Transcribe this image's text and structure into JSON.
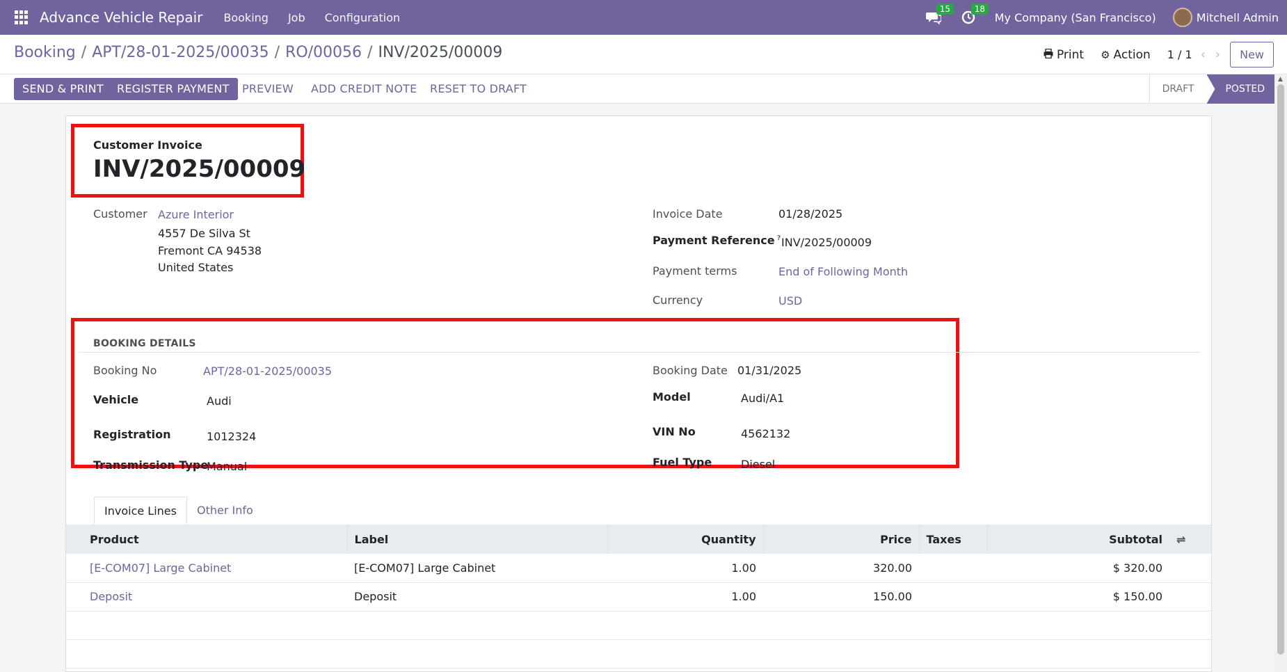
{
  "navbar": {
    "app_title": "Advance Vehicle Repair",
    "menu": [
      "Booking",
      "Job",
      "Configuration"
    ],
    "messages_count": "15",
    "activities_count": "18",
    "company": "My Company (San Francisco)",
    "user": "Mitchell Admin"
  },
  "control": {
    "breadcrumb": [
      "Booking",
      "APT/28-01-2025/00035",
      "RO/00056"
    ],
    "current": "INV/2025/00009",
    "print": "Print",
    "action": "Action",
    "pager": "1 / 1",
    "new": "New"
  },
  "actions": {
    "send_print": "SEND & PRINT",
    "register_payment": "REGISTER PAYMENT",
    "preview": "PREVIEW",
    "add_credit_note": "ADD CREDIT NOTE",
    "reset_to_draft": "RESET TO DRAFT"
  },
  "status": {
    "draft": "DRAFT",
    "posted": "POSTED"
  },
  "invoice": {
    "type": "Customer Invoice",
    "number": "INV/2025/00009",
    "customer_label": "Customer",
    "customer_name": "Azure Interior",
    "address1": "4557 De Silva St",
    "address2": "Fremont CA 94538",
    "address3": "United States",
    "date_label": "Invoice Date",
    "date": "01/28/2025",
    "payment_ref_label": "Payment Reference",
    "payment_ref_help": "?",
    "payment_ref": "INV/2025/00009",
    "terms_label": "Payment terms",
    "terms": "End of Following Month",
    "currency_label": "Currency",
    "currency": "USD"
  },
  "booking": {
    "title": "BOOKING DETAILS",
    "no_label": "Booking No",
    "no": "APT/28-01-2025/00035",
    "date_label": "Booking Date",
    "date": "01/31/2025",
    "vehicle_label": "Vehicle",
    "vehicle": "Audi",
    "model_label": "Model",
    "model": "Audi/A1",
    "registration_label": "Registration",
    "registration": "1012324",
    "vin_label": "VIN No",
    "vin": "4562132",
    "transmission_label": "Transmission Type",
    "transmission": "Manual",
    "fuel_label": "Fuel Type",
    "fuel": "Diesel"
  },
  "tabs": [
    "Invoice Lines",
    "Other Info"
  ],
  "lines": {
    "headers": {
      "product": "Product",
      "label": "Label",
      "quantity": "Quantity",
      "price": "Price",
      "taxes": "Taxes",
      "subtotal": "Subtotal"
    },
    "rows": [
      {
        "product": "[E-COM07] Large Cabinet",
        "label": "[E-COM07] Large Cabinet",
        "quantity": "1.00",
        "price": "320.00",
        "taxes": "",
        "subtotal": "$ 320.00"
      },
      {
        "product": "Deposit",
        "label": "Deposit",
        "quantity": "1.00",
        "price": "150.00",
        "taxes": "",
        "subtotal": "$ 150.00"
      }
    ]
  },
  "colors": {
    "brand": "#71639e",
    "highlight": "#ee1111",
    "badge": "#28a745"
  }
}
